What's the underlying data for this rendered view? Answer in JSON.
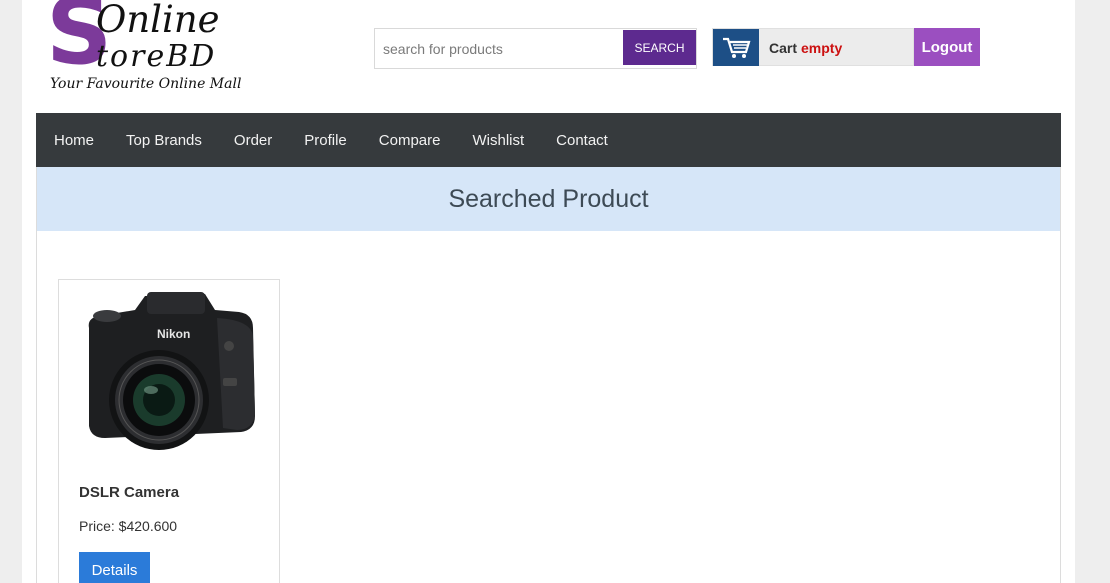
{
  "logo": {
    "letter": "S",
    "line1": "Online",
    "line2": "toreBD",
    "tagline": "Your Favourite Online Mall"
  },
  "search": {
    "placeholder": "search for products",
    "value": "",
    "button_label": "SEARCH"
  },
  "cart": {
    "label": "Cart",
    "status": "empty",
    "icon": "shopping-cart-icon"
  },
  "logout_label": "Logout",
  "nav": {
    "items": [
      {
        "label": "Home"
      },
      {
        "label": "Top Brands"
      },
      {
        "label": "Order"
      },
      {
        "label": "Profile"
      },
      {
        "label": "Compare"
      },
      {
        "label": "Wishlist"
      },
      {
        "label": "Contact"
      }
    ]
  },
  "main": {
    "heading": "Searched Product",
    "products": [
      {
        "name": "DSLR Camera",
        "price": "Price: $420.600",
        "details_label": "Details",
        "brand": "Nikon"
      }
    ]
  },
  "colors": {
    "brand_purple": "#5d2a8f",
    "nav_bg": "#363a3d",
    "header_bg": "#d6e6f8",
    "details_blue": "#2b7bd9"
  }
}
